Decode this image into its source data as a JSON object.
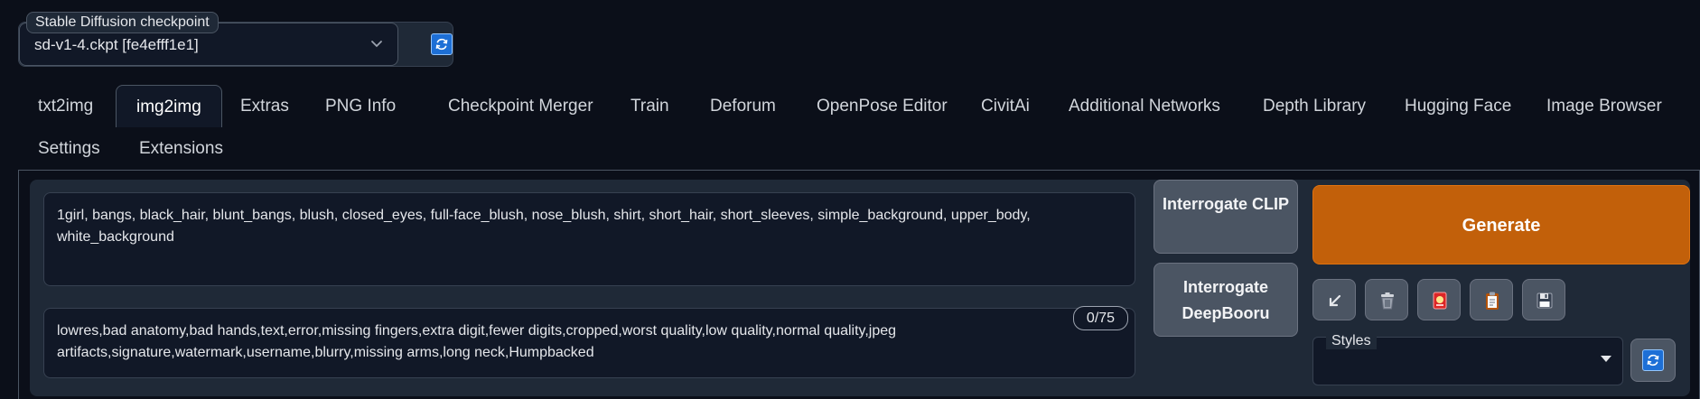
{
  "checkpoint": {
    "label": "Stable Diffusion checkpoint",
    "value": "sd-v1-4.ckpt [fe4efff1e1]"
  },
  "tabs": [
    {
      "label": "txt2img",
      "active": false
    },
    {
      "label": "img2img",
      "active": true
    },
    {
      "label": "Extras",
      "active": false
    },
    {
      "label": "PNG Info",
      "active": false
    },
    {
      "label": "Checkpoint Merger",
      "active": false
    },
    {
      "label": "Train",
      "active": false
    },
    {
      "label": "Deforum",
      "active": false
    },
    {
      "label": "OpenPose Editor",
      "active": false
    },
    {
      "label": "CivitAi",
      "active": false
    },
    {
      "label": "Additional Networks",
      "active": false
    },
    {
      "label": "Depth Library",
      "active": false
    },
    {
      "label": "Hugging Face",
      "active": false
    },
    {
      "label": "Image Browser",
      "active": false
    },
    {
      "label": "Settings",
      "active": false
    },
    {
      "label": "Extensions",
      "active": false
    }
  ],
  "prompt": {
    "value": "1girl, bangs, black_hair, blunt_bangs, blush, closed_eyes, full-face_blush, nose_blush, shirt, short_hair, short_sleeves, simple_background, upper_body, white_background"
  },
  "negative_prompt": {
    "value": "lowres,bad anatomy,bad hands,text,error,missing fingers,extra digit,fewer digits,cropped,worst quality,low quality,normal quality,jpeg artifacts,signature,watermark,username,blurry,missing arms,long neck,Humpbacked",
    "token_counter": "0/75"
  },
  "buttons": {
    "interrogate_clip": "Interrogate CLIP",
    "interrogate_deepbooru": "Interrogate DeepBooru",
    "generate": "Generate"
  },
  "tools": [
    {
      "icon": "arrow-down-left-icon"
    },
    {
      "icon": "trash-icon"
    },
    {
      "icon": "red-card-icon"
    },
    {
      "icon": "clipboard-icon"
    },
    {
      "icon": "floppy-disk-icon"
    }
  ],
  "styles": {
    "label": "Styles",
    "value": ""
  },
  "colors": {
    "accent": "#c2600a",
    "background": "#0b0f19",
    "panel": "#1f2937",
    "refresh": "#1d6fd6"
  }
}
